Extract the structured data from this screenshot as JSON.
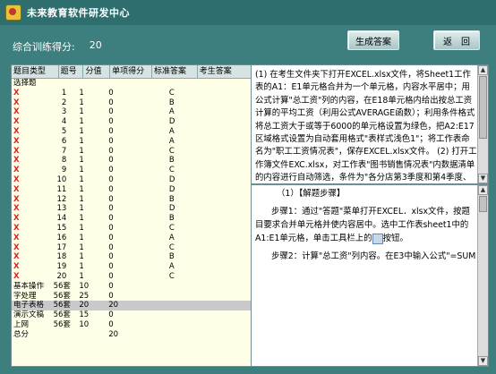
{
  "app": {
    "title": "未来教育软件研发中心",
    "icon": "app-logo-icon"
  },
  "header": {
    "score_label": "综合训练得分:",
    "score_value": "20"
  },
  "toolbar": {
    "generate_label": "生成答案",
    "back_label": "返　回"
  },
  "table": {
    "columns": [
      "题目类型",
      "题号",
      "分值",
      "单项得分",
      "标准答案",
      "考生答案"
    ],
    "rows": [
      {
        "type": "选择题",
        "no": "",
        "value": "",
        "score": "",
        "answer": "",
        "mark": ""
      },
      {
        "type": "X",
        "no": "1",
        "value": "1",
        "score": "0",
        "answer": "C",
        "mark": "x"
      },
      {
        "type": "X",
        "no": "2",
        "value": "1",
        "score": "0",
        "answer": "B",
        "mark": "x"
      },
      {
        "type": "X",
        "no": "3",
        "value": "1",
        "score": "0",
        "answer": "A",
        "mark": "x"
      },
      {
        "type": "X",
        "no": "4",
        "value": "1",
        "score": "0",
        "answer": "D",
        "mark": "x"
      },
      {
        "type": "X",
        "no": "5",
        "value": "1",
        "score": "0",
        "answer": "A",
        "mark": "x"
      },
      {
        "type": "X",
        "no": "6",
        "value": "1",
        "score": "0",
        "answer": "A",
        "mark": "x"
      },
      {
        "type": "X",
        "no": "7",
        "value": "1",
        "score": "0",
        "answer": "C",
        "mark": "x"
      },
      {
        "type": "X",
        "no": "8",
        "value": "1",
        "score": "0",
        "answer": "B",
        "mark": "x"
      },
      {
        "type": "X",
        "no": "9",
        "value": "1",
        "score": "0",
        "answer": "C",
        "mark": "x"
      },
      {
        "type": "X",
        "no": "10",
        "value": "1",
        "score": "0",
        "answer": "D",
        "mark": "x"
      },
      {
        "type": "X",
        "no": "11",
        "value": "1",
        "score": "0",
        "answer": "D",
        "mark": "x"
      },
      {
        "type": "X",
        "no": "12",
        "value": "1",
        "score": "0",
        "answer": "B",
        "mark": "x"
      },
      {
        "type": "X",
        "no": "13",
        "value": "1",
        "score": "0",
        "answer": "D",
        "mark": "x"
      },
      {
        "type": "X",
        "no": "14",
        "value": "1",
        "score": "0",
        "answer": "B",
        "mark": "x"
      },
      {
        "type": "X",
        "no": "15",
        "value": "1",
        "score": "0",
        "answer": "C",
        "mark": "x"
      },
      {
        "type": "X",
        "no": "16",
        "value": "1",
        "score": "0",
        "answer": "A",
        "mark": "x"
      },
      {
        "type": "X",
        "no": "17",
        "value": "1",
        "score": "0",
        "answer": "C",
        "mark": "x"
      },
      {
        "type": "X",
        "no": "18",
        "value": "1",
        "score": "0",
        "answer": "B",
        "mark": "x"
      },
      {
        "type": "X",
        "no": "19",
        "value": "1",
        "score": "0",
        "answer": "A",
        "mark": "x"
      },
      {
        "type": "X",
        "no": "20",
        "value": "1",
        "score": "0",
        "answer": "C",
        "mark": "x"
      },
      {
        "type": "基本操作",
        "no": "56套",
        "value": "10",
        "score": "0",
        "answer": "",
        "mark": ""
      },
      {
        "type": "字处理",
        "no": "56套",
        "value": "25",
        "score": "0",
        "answer": "",
        "mark": ""
      },
      {
        "type": "电子表格",
        "no": "56套",
        "value": "20",
        "score": "20",
        "answer": "",
        "mark": "",
        "selected": true
      },
      {
        "type": "演示文稿",
        "no": "56套",
        "value": "15",
        "score": "0",
        "answer": "",
        "mark": ""
      },
      {
        "type": "上网",
        "no": "56套",
        "value": "10",
        "score": "0",
        "answer": "",
        "mark": ""
      },
      {
        "type": "总分",
        "no": "",
        "value": "",
        "score": "20",
        "answer": "",
        "mark": ""
      }
    ]
  },
  "question": {
    "text": "(1) 在考生文件夹下打开EXCEL.xlsx文件，将Sheet1工作表的A1：E1单元格合并为一个单元格，内容水平居中；用公式计算\"总工资\"列的内容，在E18单元格内给出按总工资计算的平均工资（利用公式AVERAGE函数）；利用条件格式将总工资大于或等于6000的单元格设置为绿色，把A2:E17区域格式设置为自动套用格式\"表样式浅色1\"；将工作表命名为\"职工工资情况表\"，保存EXCEL.xlsx文件。 (2) 打开工作簿文件EXC.xlsx，对工作表\"图书销售情况表\"内数据清单的内容进行自动筛选，条件为\"各分店第3季度和第4季度、销售数量超过200的图书\"，工作表名不变，保"
  },
  "solution": {
    "heading": "（1）【解题步骤】",
    "step1_a": "步骤1：通过\"答题\"菜单打开EXCEL．xlsx文件，按题目要求合并单元格并使内容居中。选中工作表sheet1中的A1:E1单元格，单击工具栏上的",
    "step1_b": "按钮。",
    "step2": "步骤2：计算\"总工资\"列内容。在E3中输入公式\"=SUM"
  }
}
